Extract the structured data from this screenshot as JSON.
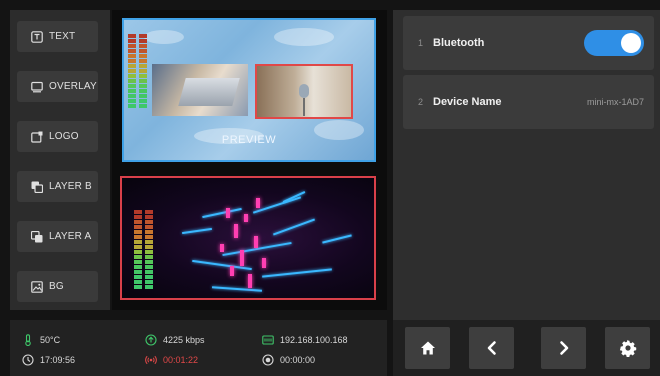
{
  "side_buttons": [
    {
      "label": "TEXT",
      "icon": "text-icon"
    },
    {
      "label": "OVERLAY",
      "icon": "overlay-icon"
    },
    {
      "label": "LOGO",
      "icon": "logo-icon"
    },
    {
      "label": "LAYER B",
      "icon": "layer-b-icon"
    },
    {
      "label": "LAYER A",
      "icon": "layer-a-icon"
    },
    {
      "label": "BG",
      "icon": "image-icon"
    }
  ],
  "preview": {
    "label": "PREVIEW"
  },
  "settings": {
    "rows": [
      {
        "index": "1",
        "label": "Bluetooth",
        "toggle_on": true
      },
      {
        "index": "2",
        "label": "Device Name",
        "value": "mini-mx-1AD7"
      }
    ]
  },
  "status": {
    "temperature": "50°C",
    "time": "17:09:56",
    "bitrate": "4225 kbps",
    "stream_time": "00:01:22",
    "ip": "192.168.100.168",
    "record_time": "00:00:00"
  },
  "nav": {
    "home": "home-icon",
    "prev": "chevron-left-icon",
    "next": "chevron-right-icon",
    "settings": "gear-icon"
  },
  "colors": {
    "accent_blue": "#2f8fe6",
    "preview_border": "#3fa1e6",
    "program_border": "#d9404a",
    "temp_green": "#3fc76a",
    "stream_red": "#e04848"
  }
}
